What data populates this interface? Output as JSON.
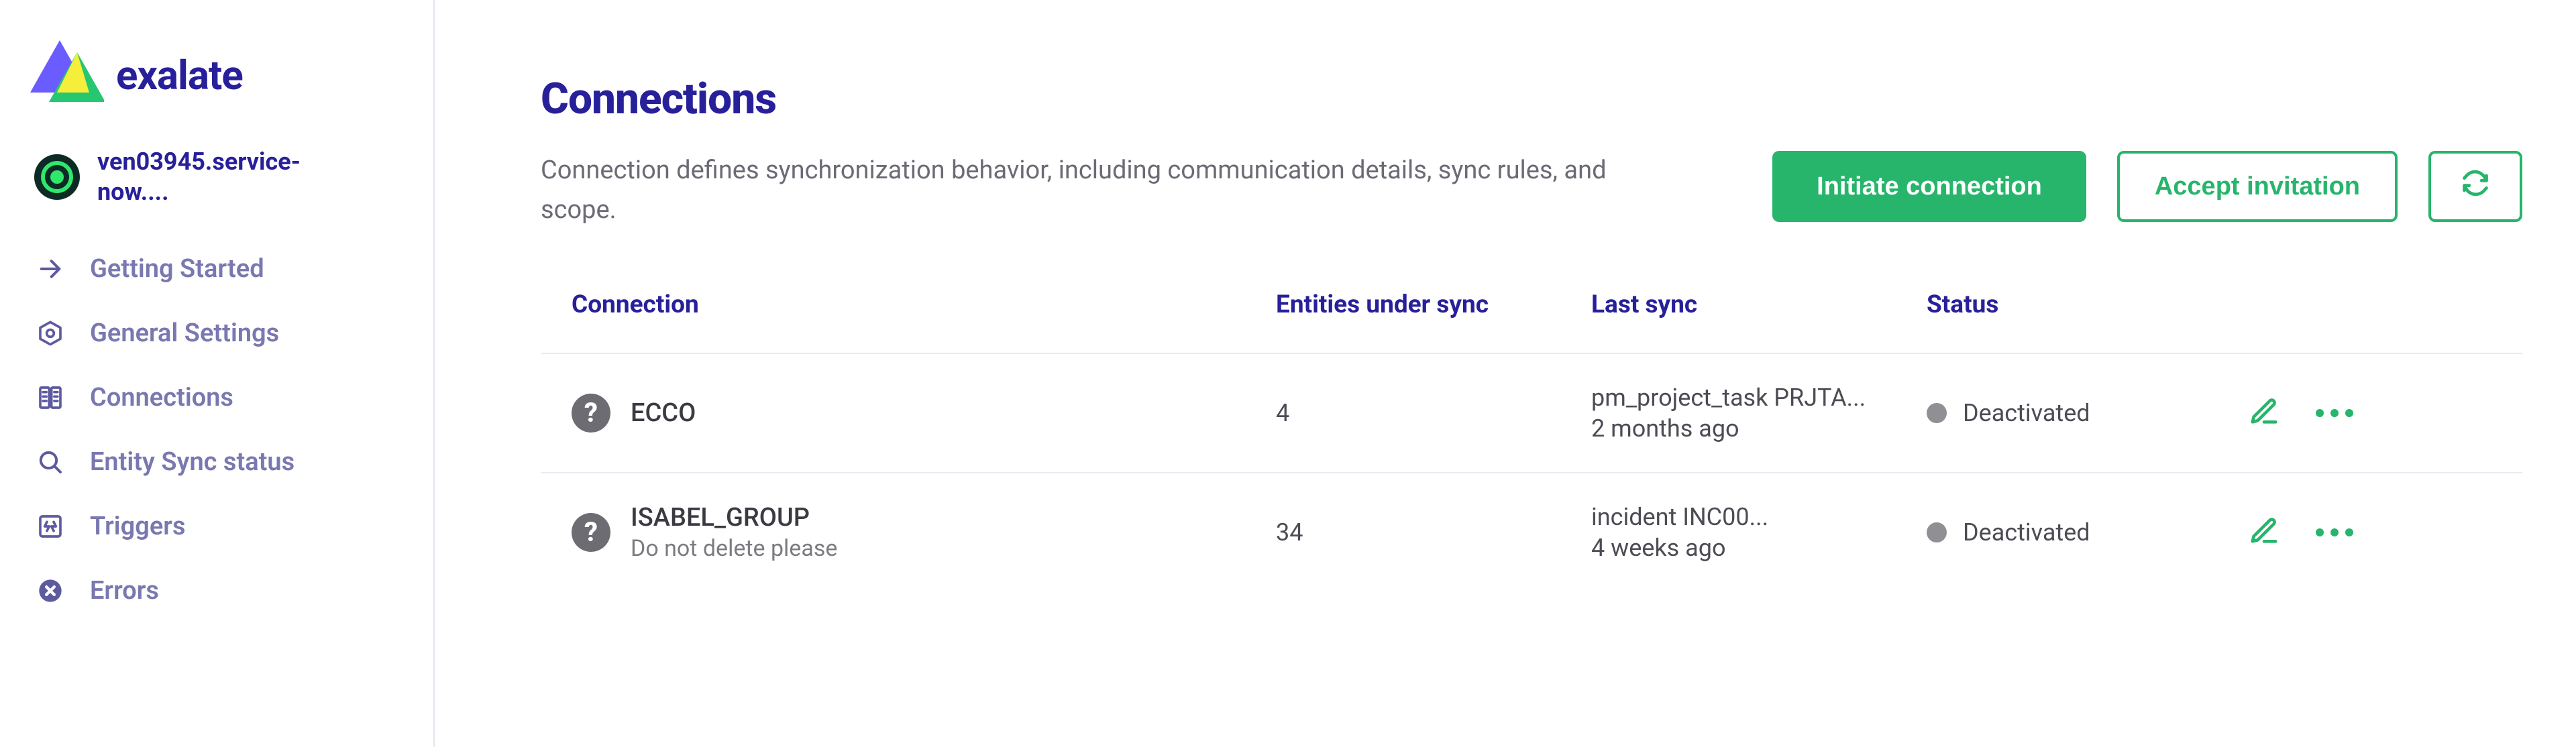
{
  "brand": {
    "name": "exalate"
  },
  "tenant": {
    "label": "ven03945.service-now...."
  },
  "sidebar": {
    "items": [
      {
        "icon": "arrow-right",
        "label": "Getting Started"
      },
      {
        "icon": "gear",
        "label": "General Settings"
      },
      {
        "icon": "connections",
        "label": "Connections"
      },
      {
        "icon": "search",
        "label": "Entity Sync status"
      },
      {
        "icon": "triggers",
        "label": "Triggers"
      },
      {
        "icon": "error",
        "label": "Errors"
      }
    ]
  },
  "page": {
    "title": "Connections",
    "subtitle": "Connection defines synchronization behavior, including communication details, sync rules, and scope."
  },
  "actions": {
    "initiate": "Initiate connection",
    "accept": "Accept invitation"
  },
  "table": {
    "headers": {
      "connection": "Connection",
      "entities": "Entities under sync",
      "lastsync": "Last sync",
      "status": "Status"
    },
    "rows": [
      {
        "name": "ECCO",
        "note": "",
        "entities": "4",
        "lastsync_item": "pm_project_task PRJTA...",
        "lastsync_ago": "2 months ago",
        "status": "Deactivated"
      },
      {
        "name": "ISABEL_GROUP",
        "note": "Do not delete please",
        "entities": "34",
        "lastsync_item": "incident INC00...",
        "lastsync_ago": "4 weeks ago",
        "status": "Deactivated"
      }
    ]
  }
}
